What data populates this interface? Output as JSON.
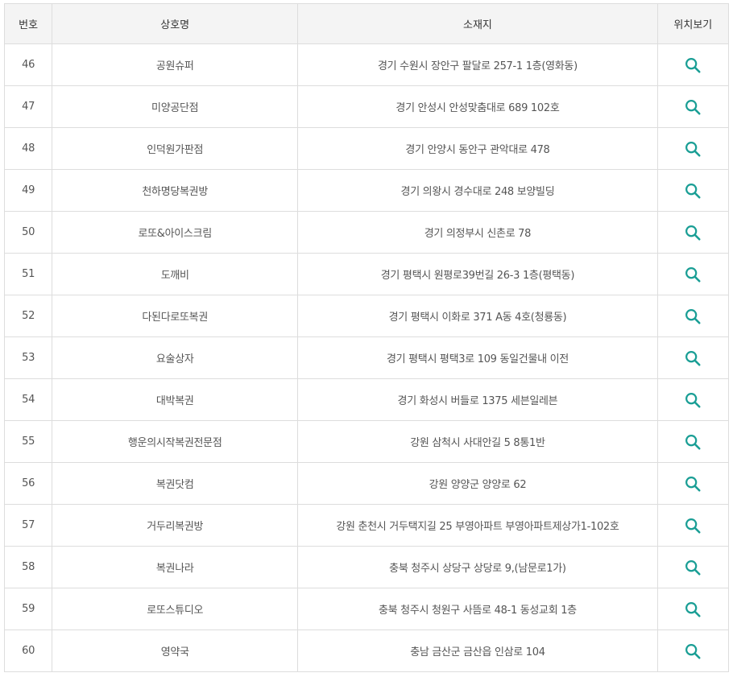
{
  "table": {
    "headers": {
      "num": "번호",
      "name": "상호명",
      "address": "소재지",
      "location": "위치보기"
    },
    "rows": [
      {
        "num": "46",
        "name": "공원슈퍼",
        "address": "경기 수원시 장안구 팔달로 257-1 1층(영화동)"
      },
      {
        "num": "47",
        "name": "미양공단점",
        "address": "경기 안성시 안성맞춤대로 689 102호"
      },
      {
        "num": "48",
        "name": "인덕원가판점",
        "address": "경기 안양시 동안구 관악대로 478"
      },
      {
        "num": "49",
        "name": "천하명당복권방",
        "address": "경기 의왕시 경수대로 248 보양빌딩"
      },
      {
        "num": "50",
        "name": "로또&아이스크림",
        "address": "경기 의정부시 신촌로 78"
      },
      {
        "num": "51",
        "name": "도깨비",
        "address": "경기 평택시 원평로39번길 26-3 1층(평택동)"
      },
      {
        "num": "52",
        "name": "다된다로또복권",
        "address": "경기 평택시 이화로 371 A동 4호(청룡동)"
      },
      {
        "num": "53",
        "name": "요술상자",
        "address": "경기 평택시 평택3로 109 동일건물내 이전"
      },
      {
        "num": "54",
        "name": "대박복권",
        "address": "경기 화성시 버들로 1375 세븐일레븐"
      },
      {
        "num": "55",
        "name": "행운의시작복권전문점",
        "address": "강원 삼척시 사대안길 5 8통1반"
      },
      {
        "num": "56",
        "name": "복권닷컴",
        "address": "강원 양양군 양양로 62"
      },
      {
        "num": "57",
        "name": "거두리복권방",
        "address": "강원 춘천시 거두택지길 25 부영아파트 부영아파트제상가1-102호"
      },
      {
        "num": "58",
        "name": "복권나라",
        "address": "충북 청주시 상당구 상당로 9,(남문로1가)"
      },
      {
        "num": "59",
        "name": "로또스튜디오",
        "address": "충북 청주시 청원구 사뜸로 48-1 동성교회 1층"
      },
      {
        "num": "60",
        "name": "영약국",
        "address": "충남 금산군 금산읍 인삼로 104"
      }
    ],
    "location_icon": "search-icon",
    "colors": {
      "icon": "#1a9e95",
      "header_bg": "#f4f4f4",
      "top_border": "#444444",
      "border": "#dddddd"
    }
  }
}
